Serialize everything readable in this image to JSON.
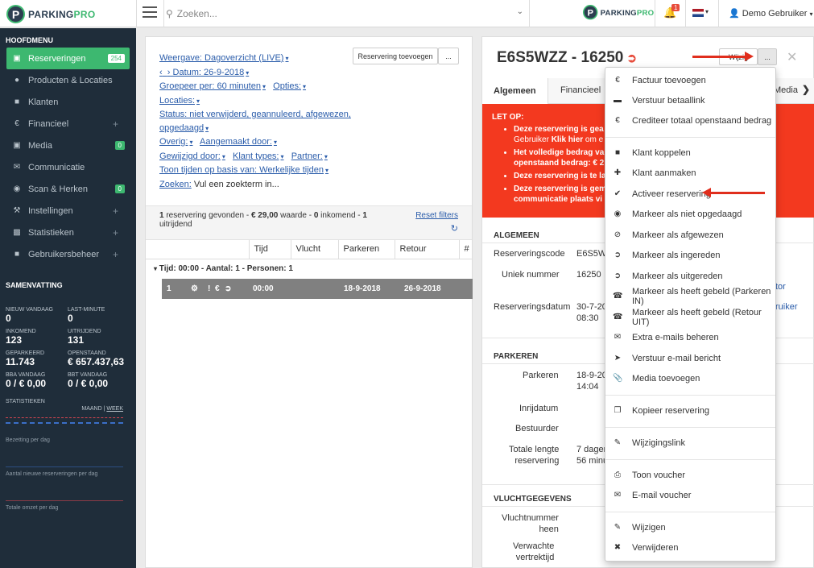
{
  "topbar": {
    "logo": {
      "part1": "PARKING",
      "part2": "PRO"
    },
    "search_placeholder": "Zoeken...",
    "notifications": "1",
    "user": "Demo Gebruiker"
  },
  "sidebar": {
    "section1": "HOOFDMENU",
    "items": [
      {
        "label": "Reserveringen",
        "count": "254",
        "icon": "calendar-icon"
      },
      {
        "label": "Producten & Locaties",
        "icon": "map-marker-icon"
      },
      {
        "label": "Klanten",
        "icon": "user-icon"
      },
      {
        "label": "Financieel",
        "icon": "euro-icon"
      },
      {
        "label": "Media",
        "count": "0",
        "icon": "image-icon"
      },
      {
        "label": "Communicatie",
        "icon": "envelope-icon"
      },
      {
        "label": "Scan & Herken",
        "count": "0",
        "icon": "camera-icon"
      },
      {
        "label": "Instellingen",
        "icon": "wrench-icon"
      },
      {
        "label": "Statistieken",
        "icon": "bar-chart-icon"
      },
      {
        "label": "Gebruikersbeheer",
        "icon": "lock-icon"
      }
    ],
    "section2": "SAMENVATTING",
    "summary": [
      {
        "label": "NIEUW VANDAAG",
        "value": "0"
      },
      {
        "label": "LAST-MINUTE",
        "value": "0"
      },
      {
        "label": "INKOMEND",
        "value": "123"
      },
      {
        "label": "UITRIJDEND",
        "value": "131"
      },
      {
        "label": "GEPARKEERD",
        "value": "11.743"
      },
      {
        "label": "OPENSTAAND",
        "value": "€ 657.437,63"
      },
      {
        "label": "BBA VANDAAG",
        "value": "0 / € 0,00"
      },
      {
        "label": "BBT VANDAAG",
        "value": "0 / € 0,00"
      }
    ],
    "stats_title": "STATISTIEKEN",
    "stats_maand": "MAAND",
    "stats_sep": "|",
    "stats_week": "WEEK",
    "spark1": "Bezetting per dag",
    "spark2": "Aantal nieuwe reserveringen per dag",
    "spark3": "Totale omzet per dag"
  },
  "left": {
    "add_button": "Reservering toevoegen",
    "more_button": "...",
    "weergave": "Weergave: Dagoverzicht (LIVE)",
    "datum": "Datum: 26-9-2018",
    "groepeer": "Groepeer per: 60 minuten",
    "opties": "Opties:",
    "locaties": "Locaties:",
    "status1": "Status: niet verwijderd, geannuleerd, afgewezen,",
    "status2": "opgedaagd",
    "overig": "Overig:",
    "aangemaakt": "Aangemaakt door:",
    "gewijzigd": "Gewijzigd door:",
    "klanttypes": "Klant types:",
    "partner": "Partner:",
    "toon": "Toon tijden op basis van: Werkelijke tijden",
    "zoeken_label": "Zoeken:",
    "zoeken_value": "Vul een zoekterm in...",
    "result_count": "1",
    "result_mid": "reservering gevonden -",
    "result_amount": "€ 29,00",
    "result_waarde": "waarde -",
    "result_in": "0",
    "result_inkomend": "inkomend -",
    "result_out": "1",
    "result_uitrijdend": "uitrijdend",
    "reset": "Reset filters",
    "headers": [
      "Tijd",
      "Vlucht",
      "Parkeren",
      "Retour",
      "#"
    ],
    "group": "Tijd: 00:00 - Aantal: 1 - Personen: 1",
    "row": {
      "nr": "1",
      "tijd": "00:00",
      "parkeren": "18-9-2018",
      "retour": "26-9-2018"
    }
  },
  "right": {
    "code": "E6S5WZZ - 16250",
    "wijzig": "Wijzig",
    "more": "...",
    "tabs": [
      "Algemeen",
      "Financieel",
      "Media"
    ],
    "alert_title": "LET OP:",
    "alerts": [
      {
        "a": "Deze reservering is gea",
        "b": "Gebruiker ",
        "c": "Klik hier",
        "d": " om e"
      },
      {
        "a": "Het volledige bedrag va",
        "b": "openstaand bedrag: € 2"
      },
      {
        "a": "Deze reservering is te la"
      },
      {
        "a": "Deze reservering is gem",
        "b": "communicatie plaats vi"
      }
    ],
    "algemeen": "ALGEMEEN",
    "reserveringscode_k": "Reserveringscode",
    "reserveringscode_v": "E6S5WZ",
    "uniek_k": "Uniek nummer",
    "uniek_v": "16250",
    "datum_k": "Reserveringsdatum",
    "datum_v1": "30-7-20",
    "datum_v2": "08:30",
    "side_link1": "tor",
    "side_link2": "ruiker",
    "parkeren_h": "PARKEREN",
    "parkeren_k": "Parkeren",
    "parkeren_v1": "18-9-20",
    "parkeren_v2": "14:04",
    "inrijdatum_k": "Inrijdatum",
    "bestuurder_k": "Bestuurder",
    "lengte_k1": "Totale lengte",
    "lengte_k2": "reservering",
    "lengte_v1": "7 dagen",
    "lengte_v2": "56 minu",
    "vlucht_h": "VLUCHTGEGEVENS",
    "vluchtnr_k1": "Vluchtnummer",
    "vluchtnr_k2": "heen",
    "vertrek_k1": "Verwachte",
    "vertrek_k2": "vertrektijd"
  },
  "menu": [
    {
      "label": "Factuur toevoegen",
      "icon": "euro-icon"
    },
    {
      "label": "Verstuur betaallink",
      "icon": "card-icon"
    },
    {
      "label": "Crediteer totaal openstaand bedrag",
      "icon": "euro-icon"
    },
    {
      "label": "Klant koppelen",
      "icon": "user-icon"
    },
    {
      "label": "Klant aanmaken",
      "icon": "plus-icon"
    },
    {
      "label": "Activeer reservering",
      "icon": "check-circle-icon"
    },
    {
      "label": "Markeer als niet opgedaagd",
      "icon": "eye-slash-icon"
    },
    {
      "label": "Markeer als afgewezen",
      "icon": "ban-icon"
    },
    {
      "label": "Markeer als ingereden",
      "icon": "sign-in-icon"
    },
    {
      "label": "Markeer als uitgereden",
      "icon": "sign-out-icon"
    },
    {
      "label": "Markeer als heeft gebeld (Parkeren IN)",
      "icon": "phone-icon"
    },
    {
      "label": "Markeer als heeft gebeld (Retour UIT)",
      "icon": "phone-icon"
    },
    {
      "label": "Extra e-mails beheren",
      "icon": "envelope-icon"
    },
    {
      "label": "Verstuur e-mail bericht",
      "icon": "send-icon"
    },
    {
      "label": "Media toevoegen",
      "icon": "paperclip-icon"
    },
    {
      "label": "Kopieer reservering",
      "icon": "copy-icon"
    },
    {
      "label": "Wijzigingslink",
      "icon": "pencil-icon"
    },
    {
      "label": "Toon voucher",
      "icon": "print-icon"
    },
    {
      "label": "E-mail voucher",
      "icon": "envelope-icon"
    },
    {
      "label": "Wijzigen",
      "icon": "pencil-icon"
    },
    {
      "label": "Verwijderen",
      "icon": "times-icon"
    }
  ],
  "colors": {
    "accent": "#3db870",
    "sidebar": "#1f2d3a",
    "alert": "#f3391f",
    "annotation": "#e02e1d"
  }
}
